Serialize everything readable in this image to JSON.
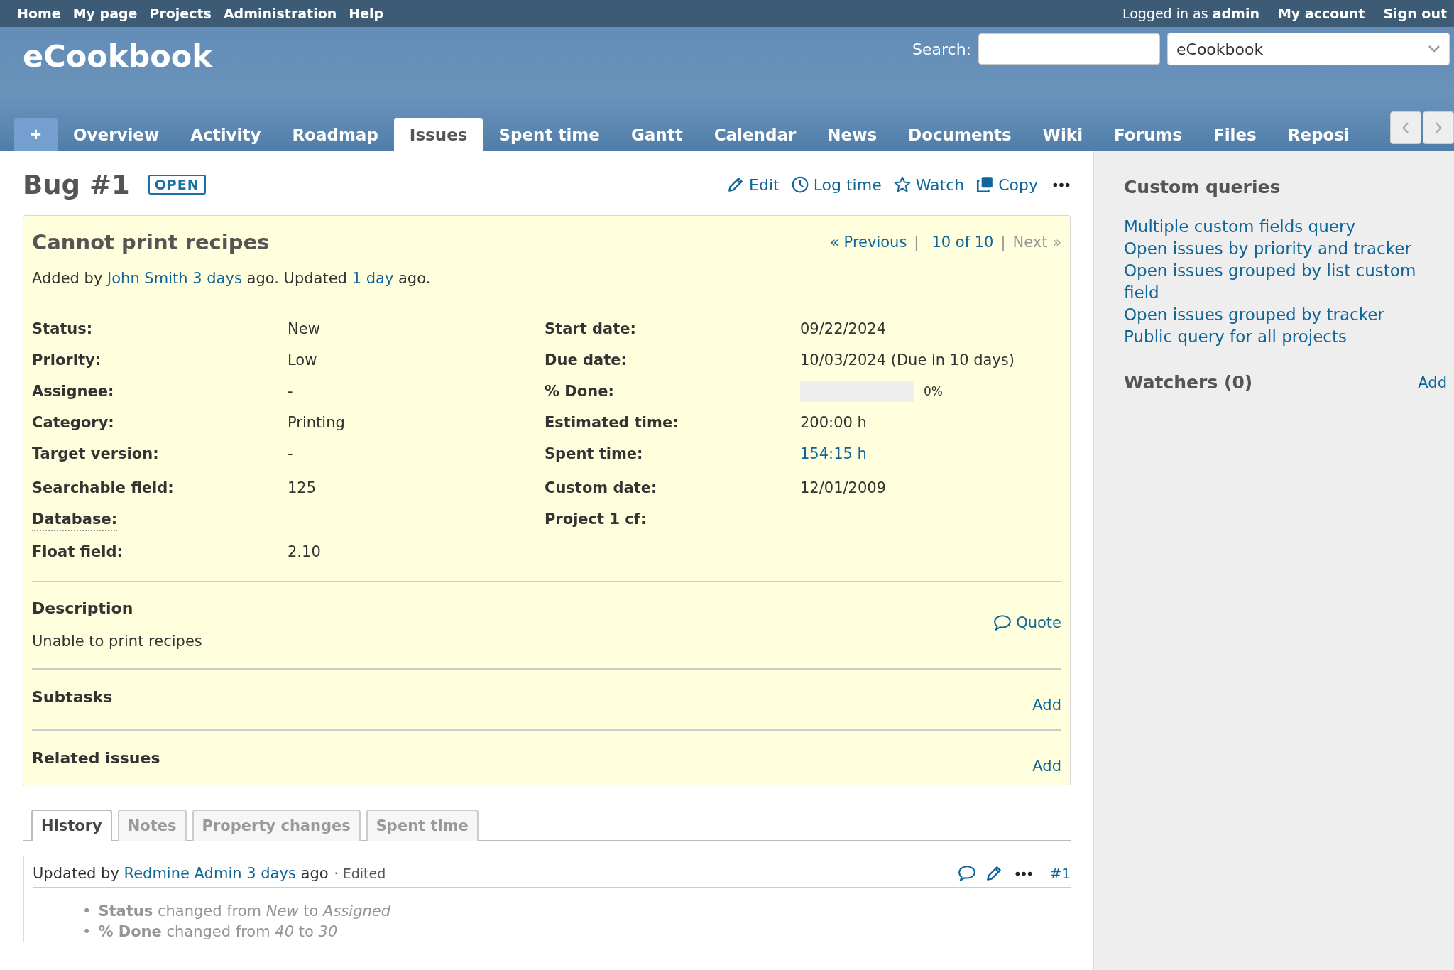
{
  "top_menu": {
    "links": [
      "Home",
      "My page",
      "Projects",
      "Administration",
      "Help"
    ],
    "logged_in_text": "Logged in as",
    "user": "admin",
    "account_links": [
      "My account",
      "Sign out"
    ]
  },
  "header": {
    "title": "eCookbook",
    "search_label": "Search:",
    "project_select": "eCookbook"
  },
  "main_menu": {
    "new_button": "+",
    "tabs": [
      {
        "label": "Overview",
        "selected": false
      },
      {
        "label": "Activity",
        "selected": false
      },
      {
        "label": "Roadmap",
        "selected": false
      },
      {
        "label": "Issues",
        "selected": true
      },
      {
        "label": "Spent time",
        "selected": false
      },
      {
        "label": "Gantt",
        "selected": false
      },
      {
        "label": "Calendar",
        "selected": false
      },
      {
        "label": "News",
        "selected": false
      },
      {
        "label": "Documents",
        "selected": false
      },
      {
        "label": "Wiki",
        "selected": false
      },
      {
        "label": "Forums",
        "selected": false
      },
      {
        "label": "Files",
        "selected": false
      },
      {
        "label": "Reposi",
        "selected": false
      }
    ]
  },
  "issue": {
    "title": "Bug #1",
    "status_badge": "OPEN",
    "actions": [
      {
        "kind": "edit",
        "label": "Edit"
      },
      {
        "kind": "log_time",
        "label": "Log time"
      },
      {
        "kind": "watch",
        "label": "Watch"
      },
      {
        "kind": "copy",
        "label": "Copy"
      }
    ],
    "subject": "Cannot print recipes",
    "navigation": {
      "previous": "« Previous",
      "separator_1": "|",
      "counter": "10 of 10",
      "separator_2": "|",
      "next": "Next »",
      "next_disabled": true
    },
    "author_line": {
      "prefix": "Added by",
      "author": "John Smith",
      "created": "3 days",
      "middle": "ago. Updated",
      "updated": "1 day",
      "suffix": "ago."
    },
    "attributes": {
      "left": [
        {
          "label": "Status:",
          "kind": "text",
          "value": "New",
          "dotted": false
        },
        {
          "label": "Priority:",
          "kind": "text",
          "value": "Low",
          "dotted": false
        },
        {
          "label": "Assignee:",
          "kind": "text",
          "value": "-",
          "dotted": false
        },
        {
          "label": "Category:",
          "kind": "text",
          "value": "Printing",
          "dotted": false
        },
        {
          "label": "Target version:",
          "kind": "text",
          "value": "-",
          "dotted": false
        }
      ],
      "right": [
        {
          "label": "Start date:",
          "kind": "text",
          "value": "09/22/2024",
          "dotted": false
        },
        {
          "label": "Due date:",
          "kind": "text",
          "value": "10/03/2024 (Due in 10 days)",
          "dotted": false
        },
        {
          "label": "% Done:",
          "kind": "progress",
          "level": 0,
          "value": "0%",
          "dotted": false
        },
        {
          "label": "Estimated time:",
          "kind": "text",
          "value": "200:00 h",
          "dotted": false
        },
        {
          "label": "Spent time:",
          "kind": "link",
          "value": "154:15 h",
          "dotted": false
        }
      ]
    },
    "custom_fields": {
      "left": [
        {
          "label": "Searchable field:",
          "kind": "text",
          "value": "125",
          "dotted": false
        },
        {
          "label": "Database:",
          "kind": "empty",
          "dotted": true
        },
        {
          "label": "Float field:",
          "kind": "text",
          "value": "2.10",
          "dotted": false
        }
      ],
      "right": [
        {
          "label": "Custom date:",
          "kind": "text",
          "value": "12/01/2009",
          "dotted": false
        },
        {
          "label": "Project 1 cf:",
          "kind": "empty",
          "dotted": false
        }
      ]
    },
    "description": {
      "title": "Description",
      "quote": "Quote",
      "text": "Unable to print recipes"
    },
    "subtasks": {
      "title": "Subtasks",
      "add": "Add"
    },
    "related_issues": {
      "title": "Related issues",
      "add": "Add"
    }
  },
  "history": {
    "tabs": [
      {
        "label": "History",
        "selected": true
      },
      {
        "label": "Notes",
        "selected": false
      },
      {
        "label": "Property changes",
        "selected": false
      },
      {
        "label": "Spent time",
        "selected": false
      }
    ],
    "journal": {
      "prefix": "Updated by",
      "user": "Redmine Admin",
      "when": "3 days",
      "suffix": "ago",
      "edited": "· Edited",
      "number": "#1",
      "details": [
        {
          "marker": "•",
          "field": "Status",
          "action": "changed from",
          "old": "New",
          "connector": "to",
          "new": "Assigned"
        },
        {
          "marker": "•",
          "field": "% Done",
          "action": "changed from",
          "old": "40",
          "connector": "to",
          "new": "30"
        }
      ]
    }
  },
  "sidebar": {
    "queries_title": "Custom queries",
    "queries": [
      "Multiple custom fields query",
      "Open issues by priority and tracker",
      "Open issues grouped by list custom field",
      "Open issues grouped by tracker",
      "Public query for all projects"
    ],
    "watchers_title": "Watchers (0)",
    "watchers_add": "Add"
  }
}
